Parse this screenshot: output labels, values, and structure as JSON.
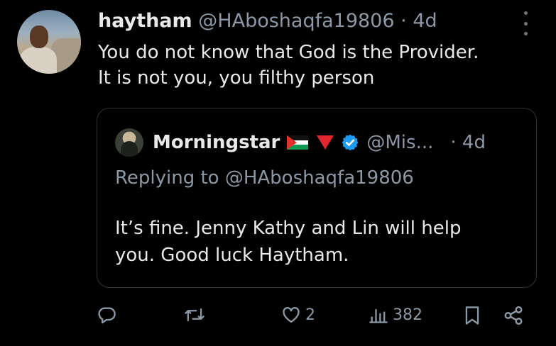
{
  "post": {
    "author_name": "haytham",
    "author_handle": "@HAboshaqfa19806",
    "separator": "·",
    "time": "4d",
    "text_lines": [
      "You do not know that God is the Provider.",
      "It is not you, you filthy person"
    ]
  },
  "quoted": {
    "author_name": "Morningstar",
    "author_handle": "@Mis...",
    "time": "· 4d",
    "replying_to": "Replying to @HAboshaqfa19806",
    "text_lines": [
      "It’s fine. Jenny Kathy and Lin will help",
      "you. Good luck Haytham."
    ]
  },
  "actions": {
    "reply_count": "",
    "repost_count": "",
    "like_count": "2",
    "views_count": "382"
  },
  "icons": [
    "more-icon",
    "reply-icon",
    "repost-icon",
    "like-icon",
    "views-icon",
    "bookmark-icon",
    "share-icon",
    "verified-badge-icon",
    "palestine-flag-icon",
    "red-triangle-icon"
  ],
  "colors": {
    "background": "#000000",
    "text": "#e7e9ea",
    "muted": "#8b98a5",
    "verified": "#1d9bf0"
  }
}
